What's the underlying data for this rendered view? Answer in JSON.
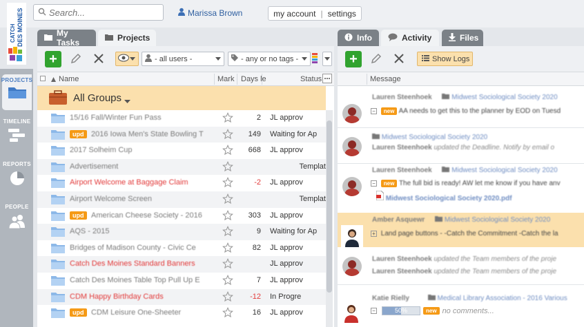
{
  "search": {
    "placeholder": "Search..."
  },
  "user": {
    "name": "Marissa Brown"
  },
  "account": {
    "my_account": "my account",
    "separator": "|",
    "settings": "settings"
  },
  "logo": {
    "text1": "CATCH",
    "text2": "DES MOINES"
  },
  "nav": {
    "projects": "PROJECTS",
    "timeline": "TIMELINE",
    "reports": "REPORTS",
    "people": "PEOPLE"
  },
  "left_tabs": {
    "my_tasks": "My Tasks",
    "projects": "Projects"
  },
  "right_tabs": {
    "info": "Info",
    "activity": "Activity",
    "files": "Files"
  },
  "filters": {
    "users": "- all users -",
    "tags": "- any or no tags -"
  },
  "columns": {
    "name": "Name",
    "mark": "Mark",
    "days": "Days le",
    "status": "Status"
  },
  "groups_label": "All Groups",
  "projects": [
    {
      "name": "15/16 Fall/Winter Fun Pass",
      "red": false,
      "upd": false,
      "days": "2",
      "days_red": false,
      "status": "JL approv",
      "status_align": "left"
    },
    {
      "name": "2016 Iowa Men's State Bowling T",
      "red": false,
      "upd": true,
      "days": "149",
      "days_red": false,
      "status": "Waiting for Ap",
      "status_align": "left"
    },
    {
      "name": "2017 Solheim Cup",
      "red": false,
      "upd": false,
      "days": "668",
      "days_red": false,
      "status": "JL approv",
      "status_align": "left"
    },
    {
      "name": "Advertisement",
      "red": false,
      "upd": false,
      "days": "",
      "days_red": false,
      "status": "Templat",
      "status_align": "right"
    },
    {
      "name": "Airport Welcome at Baggage Claim",
      "red": true,
      "upd": false,
      "days": "-2",
      "days_red": true,
      "status": "JL approv",
      "status_align": "left"
    },
    {
      "name": "Airport Welcome Screen",
      "red": false,
      "upd": false,
      "days": "",
      "days_red": false,
      "status": "Templat",
      "status_align": "right"
    },
    {
      "name": "American Cheese Society - 2016",
      "red": false,
      "upd": true,
      "days": "303",
      "days_red": false,
      "status": "JL approv",
      "status_align": "left"
    },
    {
      "name": "AQS - 2015",
      "red": false,
      "upd": false,
      "days": "9",
      "days_red": false,
      "status": "Waiting for Ap",
      "status_align": "left"
    },
    {
      "name": "Bridges of Madison County - Civic Ce",
      "red": false,
      "upd": false,
      "days": "82",
      "days_red": false,
      "status": "JL approv",
      "status_align": "left"
    },
    {
      "name": "Catch Des Moines Standard Banners",
      "red": true,
      "upd": false,
      "days": "",
      "days_red": false,
      "status": "JL approv",
      "status_align": "left"
    },
    {
      "name": "Catch Des Moines Table Top Pull Up E",
      "red": false,
      "upd": false,
      "days": "7",
      "days_red": false,
      "status": "JL approv",
      "status_align": "left"
    },
    {
      "name": "CDM Happy Birthday Cards",
      "red": true,
      "upd": false,
      "days": "-12",
      "days_red": true,
      "status": "In Progre",
      "status_align": "left"
    },
    {
      "name": "CDM Leisure One-Sheeter",
      "red": false,
      "upd": true,
      "days": "16",
      "days_red": false,
      "status": "JL approv",
      "status_align": "left"
    }
  ],
  "upd_label": "upd",
  "activity": {
    "show_logs": "Show Logs",
    "message_col": "Message",
    "new_label": "new",
    "entries": [
      {
        "who": "Lauren Steenhoek",
        "project": "Midwest Sociological Society 2020",
        "text": "AA needs to get this to the planner by EOD on Tuesd"
      },
      {
        "who": "Lauren Steenhoek",
        "project": "Midwest Sociological Society 2020",
        "text": "updated the Deadline. Notify by email o"
      },
      {
        "who": "Lauren Steenhoek",
        "project": "Midwest Sociological Society 2020",
        "text": "The full bid is ready! AW let me know if you have anv",
        "file": "Midwest Sociological Society 2020.pdf"
      },
      {
        "who": "Amber Asquewr",
        "project": "Midwest Sociological Society 2020",
        "text": "Land page buttons - -Catch the Commitment -Catch the la"
      },
      {
        "who": "Lauren Steenhoek",
        "text": "updated the Team members of the proje"
      },
      {
        "who": "Lauren Steenhoek",
        "text": "updated the Team members of the proje"
      },
      {
        "who": "Katie Rielly",
        "project": "Medical Library Association - 2016 Various",
        "progress": "50%",
        "comment": "no comments..."
      }
    ]
  },
  "colors": {
    "accent": "#fbe0ad",
    "green": "#31a32f",
    "orange": "#f59a16",
    "red": "#e23b3b"
  }
}
